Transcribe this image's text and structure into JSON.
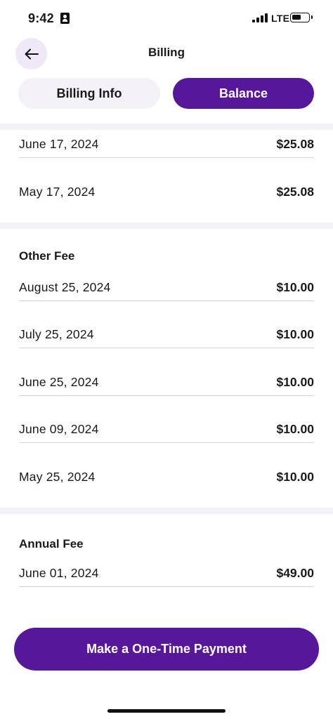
{
  "status": {
    "time": "9:42",
    "network": "LTE",
    "battery_level": 0.55
  },
  "header": {
    "title": "Billing",
    "back_icon": "arrow-left-icon"
  },
  "tabs": [
    {
      "label": "Billing Info",
      "selected": false
    },
    {
      "label": "Balance",
      "selected": true
    }
  ],
  "sections": {
    "top": {
      "rows": [
        {
          "date": "June 17, 2024",
          "amount": "$25.08"
        },
        {
          "date": "May 17, 2024",
          "amount": "$25.08"
        }
      ]
    },
    "other_fee": {
      "heading": "Other Fee",
      "rows": [
        {
          "date": "August 25, 2024",
          "amount": "$10.00"
        },
        {
          "date": "July 25, 2024",
          "amount": "$10.00"
        },
        {
          "date": "June 25, 2024",
          "amount": "$10.00"
        },
        {
          "date": "June 09, 2024",
          "amount": "$10.00"
        },
        {
          "date": "May 25, 2024",
          "amount": "$10.00"
        }
      ]
    },
    "annual_fee": {
      "heading": "Annual Fee",
      "rows": [
        {
          "date": "June 01, 2024",
          "amount": "$49.00"
        }
      ]
    }
  },
  "actions": {
    "pay_label": "Make a One-Time Payment"
  },
  "colors": {
    "accent": "#57179a",
    "tab_inactive": "#f4f2f8",
    "back_button_bg": "#efe9f7"
  }
}
